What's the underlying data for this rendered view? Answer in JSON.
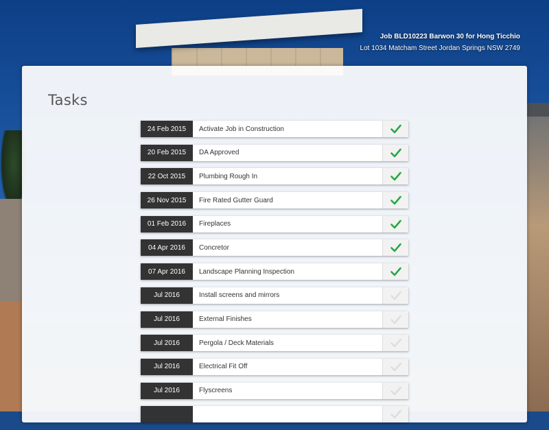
{
  "header": {
    "job_title": "Job BLD10223 Barwon 30 for Hong Ticchio",
    "address": "Lot 1034 Matcham Street Jordan Springs NSW 2749"
  },
  "panel": {
    "title": "Tasks"
  },
  "icons": {
    "status": "check-icon"
  },
  "colors": {
    "done": "#28a744",
    "pending": "#dedede",
    "date_bg": "#333333"
  },
  "tasks": [
    {
      "date": "24 Feb 2015",
      "name": "Activate Job in Construction",
      "done": true
    },
    {
      "date": "20 Feb 2015",
      "name": "DA Approved",
      "done": true
    },
    {
      "date": "22 Oct 2015",
      "name": "Plumbing Rough In",
      "done": true
    },
    {
      "date": "26 Nov 2015",
      "name": "Fire Rated Gutter Guard",
      "done": true
    },
    {
      "date": "01 Feb 2016",
      "name": "Fireplaces",
      "done": true
    },
    {
      "date": "04 Apr 2016",
      "name": "Concretor",
      "done": true
    },
    {
      "date": "07 Apr 2016",
      "name": "Landscape Planning Inspection",
      "done": true
    },
    {
      "date": "Jul 2016",
      "name": "Install screens and mirrors",
      "done": false
    },
    {
      "date": "Jul 2016",
      "name": "External Finishes",
      "done": false
    },
    {
      "date": "Jul 2016",
      "name": "Pergola / Deck Materials",
      "done": false
    },
    {
      "date": "Jul 2016",
      "name": "Electrical Fit Off",
      "done": false
    },
    {
      "date": "Jul 2016",
      "name": "Flyscreens",
      "done": false
    },
    {
      "date": "",
      "name": "",
      "done": false
    }
  ]
}
